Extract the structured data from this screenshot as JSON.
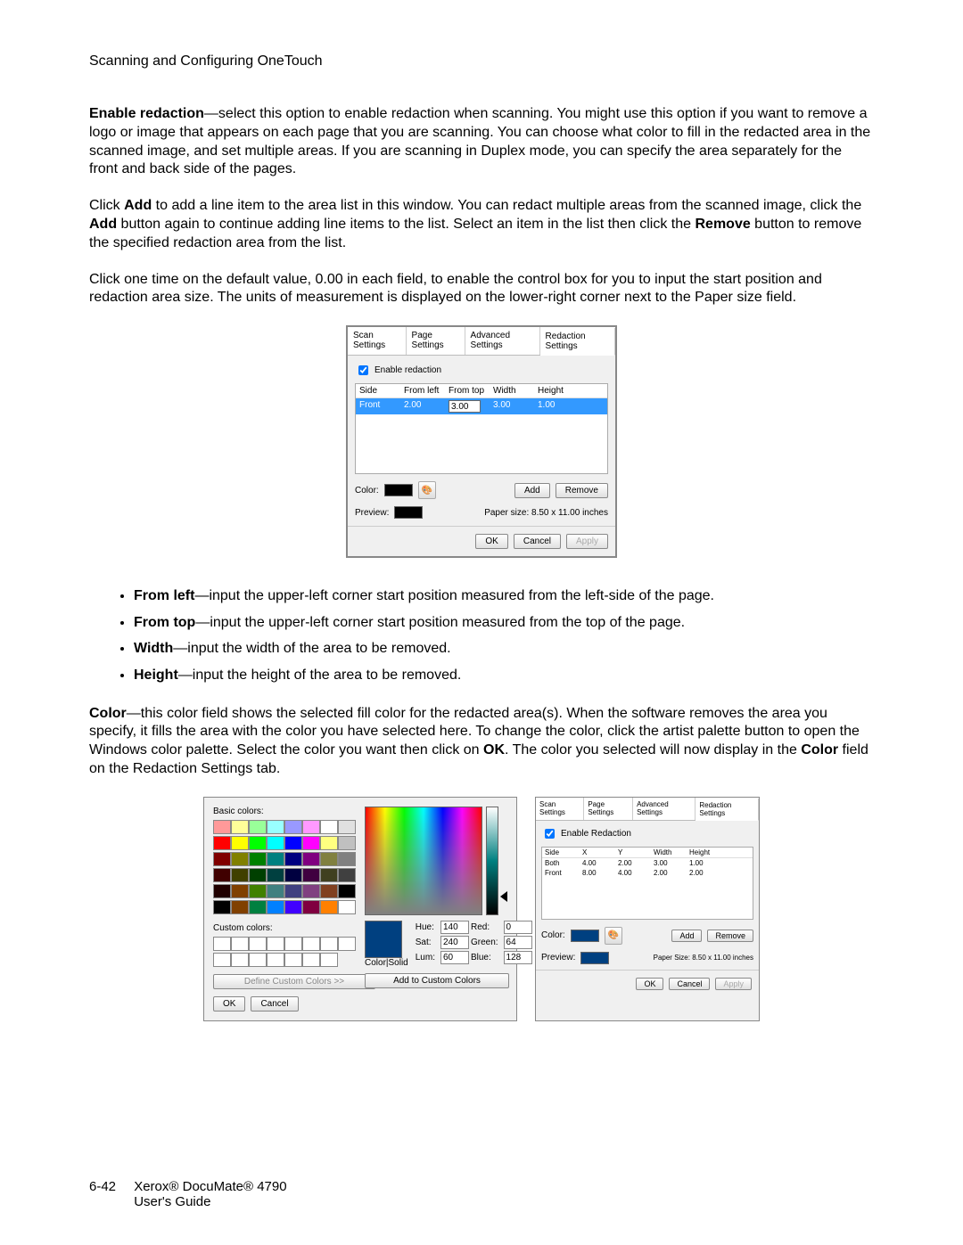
{
  "header": "Scanning and Configuring OneTouch",
  "para1": {
    "lead": "Enable redaction",
    "rest": "—select this option to enable redaction when scanning. You might use this option if you want to remove a logo or image that appears on each page that you are scanning. You can choose what color to fill in the redacted area in the scanned image, and set multiple areas. If you are scanning in Duplex mode, you can specify the area separately for the front and back side of the pages."
  },
  "para2_pre": "Click ",
  "para2_add": "Add",
  "para2_mid1": " to add a line item to the area list in this window. You can redact multiple areas from the scanned image, click the ",
  "para2_mid2": " button again to continue adding line items to the list. Select an item in the list then click the ",
  "para2_remove": "Remove",
  "para2_end": " button to remove the specified redaction area from the list.",
  "para3": "Click one time on the default value, 0.00 in each field, to enable the control box for you to input the start position and redaction area size. The units of measurement is displayed on the lower-right corner next to the Paper size field.",
  "dialog1": {
    "tabs": [
      "Scan Settings",
      "Page Settings",
      "Advanced Settings",
      "Redaction Settings"
    ],
    "active_tab": 3,
    "enable_label": "Enable redaction",
    "enable_checked": true,
    "columns": [
      "Side",
      "From left",
      "From top",
      "Width",
      "Height"
    ],
    "row": {
      "side": "Front",
      "from_left": "2.00",
      "from_top": "3.00",
      "width": "3.00",
      "height": "1.00"
    },
    "color_label": "Color:",
    "preview_label": "Preview:",
    "add_label": "Add",
    "remove_label": "Remove",
    "paper_size": "Paper size:  8.50 x 11.00 inches",
    "ok": "OK",
    "cancel": "Cancel",
    "apply": "Apply"
  },
  "bullets": [
    {
      "lead": "From left",
      "rest": "—input the upper-left corner start position measured from the left-side of the page."
    },
    {
      "lead": "From top",
      "rest": "—input the upper-left corner start position measured from the top of the page."
    },
    {
      "lead": "Width",
      "rest": "—input the width of the area to be removed."
    },
    {
      "lead": "Height",
      "rest": "—input the height of the area to be removed."
    }
  ],
  "para4": {
    "lead": "Color",
    "mid1": "—this color field shows the selected fill color for the redacted area(s). When the software removes the area you specify, it fills the area with the color you have selected here. To change the color, click the artist palette button to open the Windows color palette. Select the color you want then click on ",
    "ok": "OK",
    "mid2": ". The color you selected will now display in the ",
    "color_word": "Color",
    "end": " field on the Redaction Settings tab."
  },
  "color_dialog": {
    "basic_label": "Basic colors:",
    "custom_label": "Custom colors:",
    "define_label": "Define Custom Colors >>",
    "ok": "OK",
    "cancel": "Cancel",
    "colorsolid_label": "Color|Solid",
    "hue_label": "Hue:",
    "hue": "140",
    "sat_label": "Sat:",
    "sat": "240",
    "lum_label": "Lum:",
    "lum": "60",
    "red_label": "Red:",
    "red": "0",
    "green_label": "Green:",
    "green": "64",
    "blue_label": "Blue:",
    "blue": "128",
    "add_custom_label": "Add to Custom Colors",
    "basic_colors": [
      "#ff9999",
      "#ffff99",
      "#99ff99",
      "#99ffff",
      "#9999ff",
      "#ff99ff",
      "#ffffff",
      "#e0e0e0",
      "#ff0000",
      "#ffff00",
      "#00ff00",
      "#00ffff",
      "#0000ff",
      "#ff00ff",
      "#ffff80",
      "#c0c0c0",
      "#800000",
      "#808000",
      "#008000",
      "#008080",
      "#000080",
      "#800080",
      "#808040",
      "#808080",
      "#400000",
      "#404000",
      "#004000",
      "#004040",
      "#000040",
      "#400040",
      "#404020",
      "#404040",
      "#200000",
      "#804000",
      "#408000",
      "#408080",
      "#404080",
      "#804080",
      "#804020",
      "#000000",
      "#000000",
      "#804000",
      "#008040",
      "#0080ff",
      "#4000ff",
      "#800040",
      "#ff8000",
      "#ffffff"
    ]
  },
  "dialog3": {
    "tabs": [
      "Scan Settings",
      "Page Settings",
      "Advanced Settings",
      "Redaction Settings"
    ],
    "active_tab": 3,
    "enable_label": "Enable Redaction",
    "columns": [
      "Side",
      "X",
      "Y",
      "Width",
      "Height"
    ],
    "rows": [
      {
        "side": "Both",
        "x": "4.00",
        "y": "2.00",
        "w": "3.00",
        "h": "1.00"
      },
      {
        "side": "Front",
        "x": "8.00",
        "y": "4.00",
        "w": "2.00",
        "h": "2.00"
      }
    ],
    "color_label": "Color:",
    "preview_label": "Preview:",
    "add_label": "Add",
    "remove_label": "Remove",
    "paper_size": "Paper Size:  8.50 x 11.00 inches",
    "ok": "OK",
    "cancel": "Cancel",
    "apply": "Apply"
  },
  "footer": {
    "page": "6-42",
    "line1": "Xerox® DocuMate® 4790",
    "line2": "User's Guide"
  }
}
